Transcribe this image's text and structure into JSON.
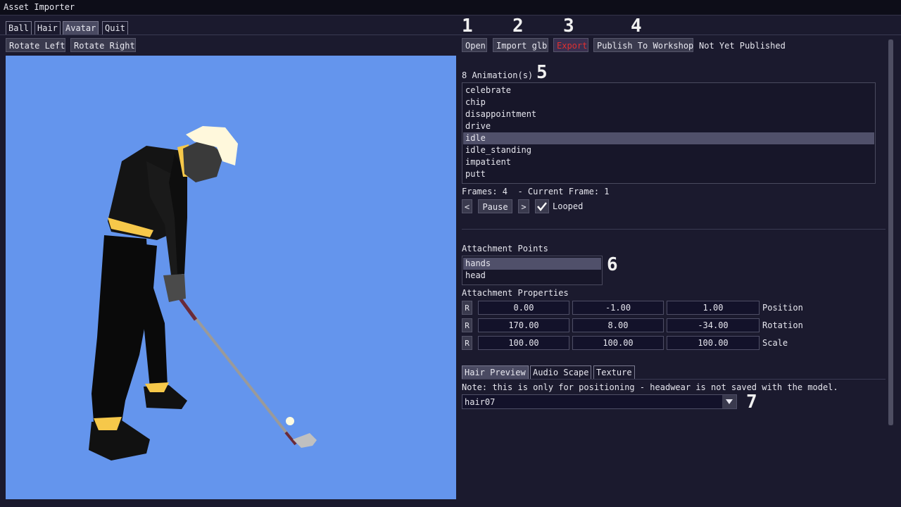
{
  "window": {
    "title": "Asset Importer"
  },
  "mode_tabs": [
    {
      "label": "Ball",
      "active": false
    },
    {
      "label": "Hair",
      "active": false
    },
    {
      "label": "Avatar",
      "active": true
    },
    {
      "label": "Quit",
      "active": false
    }
  ],
  "view_controls": {
    "rotate_left": "Rotate Left",
    "rotate_right": "Rotate Right"
  },
  "toolbar": {
    "open": "Open",
    "import_glb": "Import glb",
    "export": "Export",
    "publish": "Publish To Workshop",
    "publish_status": "Not Yet Published"
  },
  "callouts": [
    "1",
    "2",
    "3",
    "4",
    "5",
    "6",
    "7"
  ],
  "animations": {
    "count_label": "8 Animation(s)",
    "items": [
      "celebrate",
      "chip",
      "disappointment",
      "drive",
      "idle",
      "idle_standing",
      "impatient",
      "putt"
    ],
    "selected": "idle",
    "frames_label": "Frames: 4  - Current Frame: 1",
    "prev": "<",
    "pause": "Pause",
    "next": ">",
    "looped_label": "Looped",
    "looped_checked": true
  },
  "attachment_points": {
    "title": "Attachment Points",
    "items": [
      "hands",
      "head"
    ],
    "selected": "hands"
  },
  "attachment_properties": {
    "title": "Attachment Properties",
    "reset_label": "R",
    "rows": [
      {
        "values": [
          "0.00",
          "-1.00",
          "1.00"
        ],
        "label": "Position"
      },
      {
        "values": [
          "170.00",
          "8.00",
          "-34.00"
        ],
        "label": "Rotation"
      },
      {
        "values": [
          "100.00",
          "100.00",
          "100.00"
        ],
        "label": "Scale"
      }
    ]
  },
  "lower_tabs": [
    {
      "label": "Hair Preview",
      "active": true
    },
    {
      "label": "Audio Scape",
      "active": false
    },
    {
      "label": "Texture",
      "active": false
    }
  ],
  "hair_preview": {
    "note": "Note: this is only for positioning - headwear is not saved with the model.",
    "selected_hair": "hair07"
  },
  "colors": {
    "viewport_bg": "#6495ed",
    "export_text": "#e03030",
    "panel_bg": "#1b1a2e"
  }
}
